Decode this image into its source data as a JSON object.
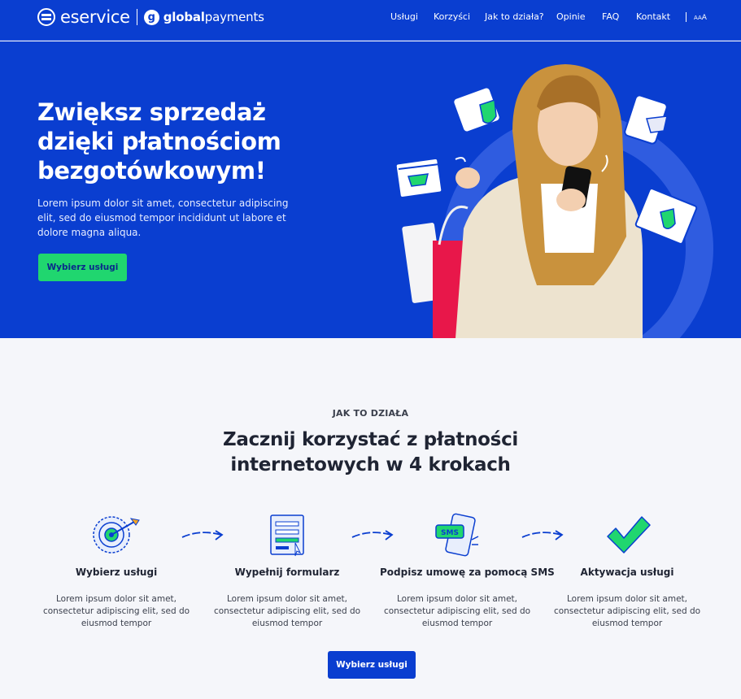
{
  "header": {
    "brand": "eservice",
    "partner_prefix": "global",
    "partner_suffix": "payments",
    "partner_letter": "g",
    "nav": [
      "Usługi",
      "Korzyści",
      "Jak to działa?",
      "Opinie",
      "FAQ",
      "Kontakt"
    ],
    "font_size_small": "A",
    "font_size_large": "A"
  },
  "hero": {
    "title": "Zwiększ sprzedaż dzięki płatnościom bezgotówkowym!",
    "text": "Lorem ipsum dolor sit amet, consectetur adipiscing elit, sed do eiusmod tempor incididunt ut labore et dolore magna aliqua.",
    "cta": "Wybierz usługi"
  },
  "how": {
    "eyebrow": "JAK TO DZIAŁA",
    "title": "Zacznij korzystać z płatności internetowych w 4 krokach",
    "sms_label": "SMS",
    "steps": [
      {
        "title": "Wybierz usługi",
        "text": "Lorem ipsum dolor sit amet, consectetur adipiscing elit, sed do eiusmod tempor"
      },
      {
        "title": "Wypełnij formularz",
        "text": "Lorem ipsum dolor sit amet, consectetur adipiscing elit, sed do eiusmod tempor"
      },
      {
        "title": "Podpisz umowę za pomocą SMS",
        "text": "Lorem ipsum dolor sit amet, consectetur adipiscing elit, sed do eiusmod tempor"
      },
      {
        "title": "Aktywacja usługi",
        "text": "Lorem ipsum dolor sit amet, consectetur adipiscing elit, sed do eiusmod tempor"
      }
    ],
    "cta": "Wybierz usługi"
  },
  "colors": {
    "brand_blue": "#0a3ed0",
    "accent_green": "#20d66f",
    "background": "#f5f6fa",
    "text_dark": "#1f2433"
  },
  "icons": [
    "eservice-logo-icon",
    "globalpayments-logo-icon",
    "target-icon",
    "form-icon",
    "sms-phone-icon",
    "checkmark-icon",
    "arrow-right-icon",
    "card-shield-icon",
    "browser-cart-icon",
    "phone-cart-icon",
    "browser-shield-icon"
  ]
}
